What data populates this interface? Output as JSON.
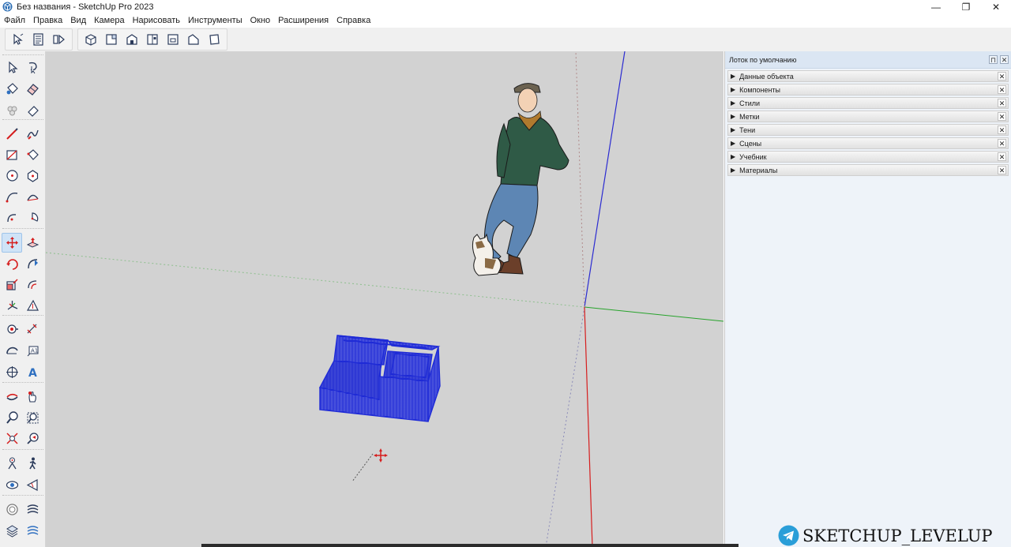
{
  "window": {
    "title": "Без названия - SketchUp Pro 2023",
    "minimize_glyph": "—",
    "maximize_glyph": "❐",
    "close_glyph": "✕"
  },
  "menu": {
    "items": [
      "Файл",
      "Правка",
      "Вид",
      "Камера",
      "Нарисовать",
      "Инструменты",
      "Окно",
      "Расширения",
      "Справка"
    ]
  },
  "toolbar": {
    "group1": [
      "select-icon",
      "model-info-icon",
      "outliner-icon"
    ],
    "group2": [
      "iso-view-icon",
      "top-view-icon",
      "front-view-icon",
      "right-view-icon",
      "back-view-icon",
      "left-view-icon",
      "bottom-view-icon"
    ]
  },
  "tools": {
    "rows": [
      [
        "select-tool-icon",
        "lasso-select-icon"
      ],
      [
        "paint-bucket-icon",
        "eraser-icon"
      ],
      [
        "make-component-icon",
        "tag-eraser-icon"
      ],
      [
        "line-tool-icon",
        "freehand-icon"
      ],
      [
        "rectangle-icon",
        "rotated-rectangle-icon"
      ],
      [
        "circle-icon",
        "polygon-icon"
      ],
      [
        "arc-icon",
        "two-point-arc-icon"
      ],
      [
        "three-point-arc-icon",
        "pie-icon"
      ],
      [
        "move-tool-icon",
        "push-pull-icon"
      ],
      [
        "rotate-icon",
        "follow-me-icon"
      ],
      [
        "scale-icon",
        "offset-icon"
      ],
      [
        "axes-icon",
        "section-plane-icon"
      ],
      [
        "tape-measure-icon",
        "dimension-icon"
      ],
      [
        "protractor-icon",
        "text-icon"
      ],
      [
        "axes-tool-icon",
        "3d-text-icon"
      ],
      [
        "orbit-icon",
        "pan-icon"
      ],
      [
        "zoom-icon",
        "zoom-window-icon"
      ],
      [
        "zoom-extents-icon",
        "previous-view-icon"
      ],
      [
        "position-camera-icon",
        "walk-icon"
      ],
      [
        "look-around-icon",
        "section-display-icon"
      ],
      [
        "warehouse-icon",
        "extension-warehouse-icon"
      ],
      [
        "layout-icon",
        "extension-manager-icon"
      ]
    ],
    "active": "move-tool-icon"
  },
  "tray": {
    "title": "Лоток по умолчанию",
    "pin_glyph": "⊓",
    "close_glyph": "✕",
    "arrow_glyph": "▶",
    "panels": [
      "Данные объекта",
      "Компоненты",
      "Стили",
      "Метки",
      "Тени",
      "Сцены",
      "Учебник",
      "Материалы"
    ]
  },
  "watermark": {
    "text": "SKETCHUP_LEVELUP"
  },
  "colors": {
    "viewport_bg": "#d2d2d2",
    "selection_blue": "#1f2bd6",
    "axis_red": "#d61e1e",
    "axis_green": "#27a32b",
    "axis_blue": "#2b2bd1",
    "tray_bg": "#eef3f9"
  }
}
